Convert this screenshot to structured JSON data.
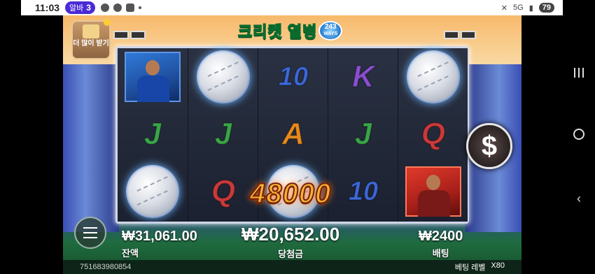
{
  "status_bar": {
    "time": "11:03",
    "badge_label": "알바",
    "badge_count": "3",
    "network": "5G",
    "battery": "79"
  },
  "game": {
    "title": "크리켓 열병",
    "ways_number": "243",
    "ways_label": "WAYS",
    "more_button_label": "더 많이 받기",
    "win_popup_amount": "48000",
    "reels": [
      [
        "player-blue",
        "J",
        "ball"
      ],
      [
        "ball",
        "J",
        "Q"
      ],
      [
        "10",
        "A",
        "ball"
      ],
      [
        "K",
        "J",
        "10"
      ],
      [
        "ball",
        "Q",
        "player-red"
      ]
    ],
    "balance_value": "₩31,061.00",
    "balance_label": "잔액",
    "win_value": "₩20,652.00",
    "win_label": "당첨금",
    "bet_value": "₩2400",
    "bet_label": "배팅",
    "spin_symbol": "$",
    "session_id": "751683980854",
    "bet_level_label": "베팅 레벨",
    "bet_level_value": "X80"
  },
  "colors": {
    "win_gold": "#f2b431",
    "title_green": "#0a6b2e",
    "ball_glow": "#6fb6ff"
  }
}
